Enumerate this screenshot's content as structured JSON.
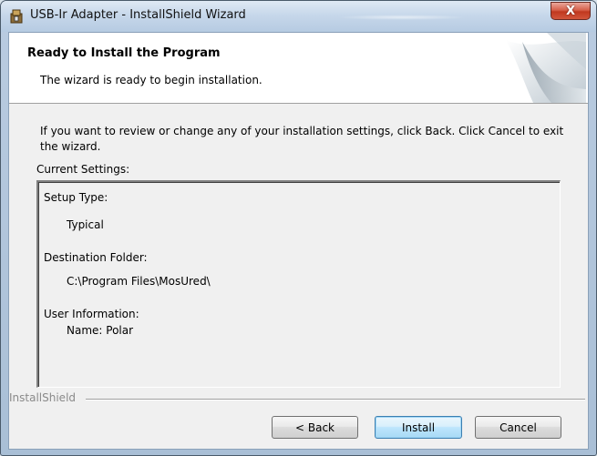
{
  "window": {
    "title": "USB-Ir Adapter - InstallShield Wizard",
    "close_label": "X"
  },
  "banner": {
    "title": "Ready to Install the Program",
    "subtitle": "The wizard is ready to begin installation."
  },
  "main": {
    "intro": "If you want to review or change any of your installation settings, click Back. Click Cancel to exit the wizard.",
    "current_settings_label": "Current Settings:",
    "settings": {
      "setup_type_label": "Setup Type:",
      "setup_type_value": "Typical",
      "destination_label": "Destination Folder:",
      "destination_value": "C:\\Program Files\\MosUred\\",
      "user_info_label": "User Information:",
      "user_name": "Name: Polar"
    }
  },
  "footer": {
    "brand": "InstallShield",
    "back_label": "< Back",
    "install_label": "Install",
    "cancel_label": "Cancel"
  }
}
